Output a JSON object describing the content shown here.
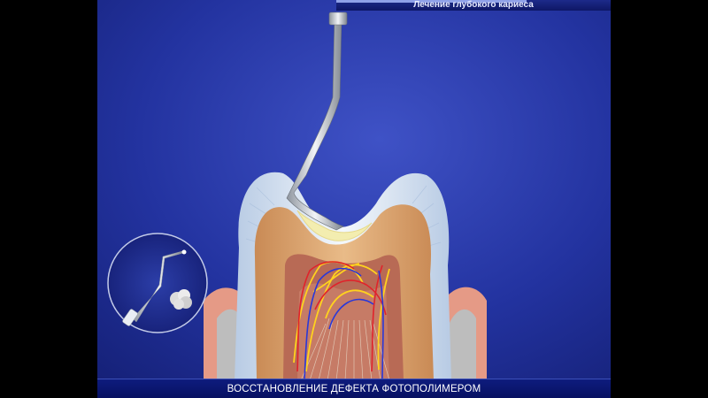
{
  "header": {
    "title": "Лечение глубокого  кариеса"
  },
  "footer": {
    "caption": "ВОССТАНОВЛЕНИЕ ДЕФЕКТА ФОТОПОЛИМЕРОМ"
  },
  "colors": {
    "background": "#1f2f94",
    "enamel": "#dfe9f4",
    "dentin": "#dca873",
    "pulp": "#b86a55",
    "gum": "#e59a86",
    "composite": "#f3edb0",
    "artery": "#e0232b",
    "vein": "#2a38d8",
    "nerve": "#ffd21e",
    "instrument": "#c9ced6"
  },
  "icons": {
    "inset": "applicator-and-cotton-icon"
  }
}
